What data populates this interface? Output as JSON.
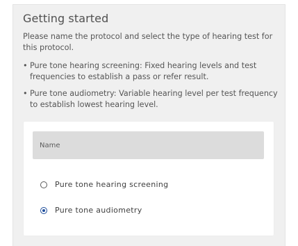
{
  "section": {
    "title": "Getting started",
    "intro": "Please name the protocol and select the type of hearing test for this protocol.",
    "bullets": [
      {
        "symbol": "•",
        "text": "Pure tone hearing screening: Fixed hearing levels and test frequencies to establish a pass or refer result."
      },
      {
        "symbol": "•",
        "text": "Pure tone audiometry: Variable hearing level per test frequency to establish lowest hearing level."
      }
    ]
  },
  "form": {
    "name_field": {
      "placeholder": "Name",
      "value": ""
    },
    "test_type": {
      "options": [
        {
          "label": "Pure tone hearing screening",
          "selected": false
        },
        {
          "label": "Pure tone audiometry",
          "selected": true
        }
      ]
    }
  },
  "colors": {
    "panel_background": "#f0f0f0",
    "field_background": "#dcdcdc",
    "radio_accent": "#1f4e9c"
  }
}
